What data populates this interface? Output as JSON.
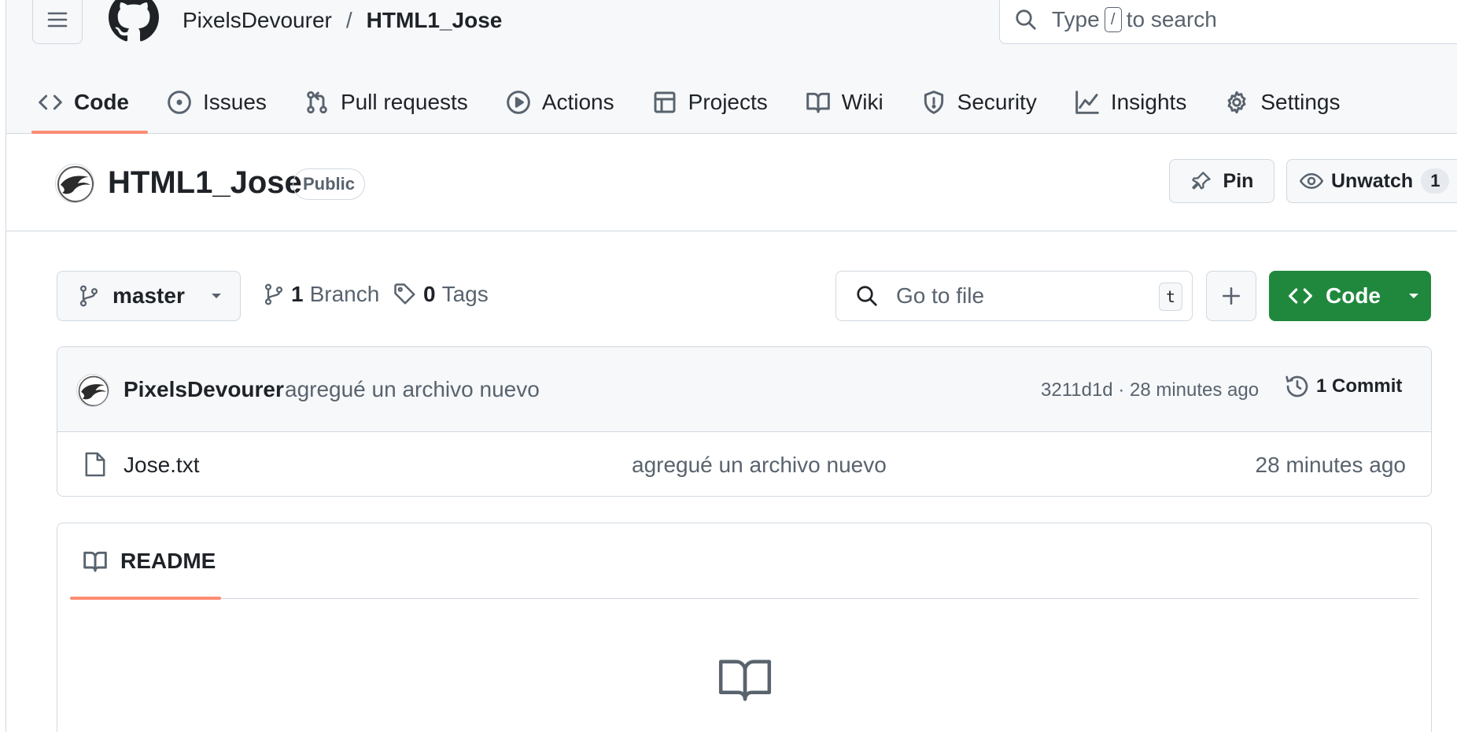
{
  "header": {
    "owner": "PixelsDevourer",
    "separator": "/",
    "repo": "HTML1_Jose",
    "search_prefix": "Type",
    "search_key": "/",
    "search_suffix": "to search"
  },
  "tabs": [
    {
      "label": "Code",
      "icon": "code-icon",
      "active": true
    },
    {
      "label": "Issues",
      "icon": "issue-icon"
    },
    {
      "label": "Pull requests",
      "icon": "pull-request-icon"
    },
    {
      "label": "Actions",
      "icon": "play-icon"
    },
    {
      "label": "Projects",
      "icon": "table-icon"
    },
    {
      "label": "Wiki",
      "icon": "book-icon"
    },
    {
      "label": "Security",
      "icon": "shield-icon"
    },
    {
      "label": "Insights",
      "icon": "graph-icon"
    },
    {
      "label": "Settings",
      "icon": "gear-icon"
    }
  ],
  "repo_bar": {
    "name": "HTML1_Jose",
    "visibility": "Public",
    "pin_label": "Pin",
    "watch_label": "Unwatch",
    "watch_count": "1"
  },
  "toolbar": {
    "branch": "master",
    "branch_count": "1",
    "branch_label": "Branch",
    "tag_count": "0",
    "tag_label": "Tags",
    "goto_placeholder": "Go to file",
    "goto_key": "t",
    "code_label": "Code"
  },
  "commit": {
    "author": "PixelsDevourer",
    "message": "agregué un archivo nuevo",
    "meta": "3211d1d · 28 minutes ago",
    "count_label": "1 Commit"
  },
  "files": [
    {
      "name": "Jose.txt",
      "message": "agregué un archivo nuevo",
      "time": "28 minutes ago"
    }
  ],
  "readme": {
    "label": "README"
  },
  "colors": {
    "accent_underline": "#fd8c73",
    "primary_green": "#1f883d",
    "border": "#d1d9e0",
    "muted_text": "#59636e"
  }
}
